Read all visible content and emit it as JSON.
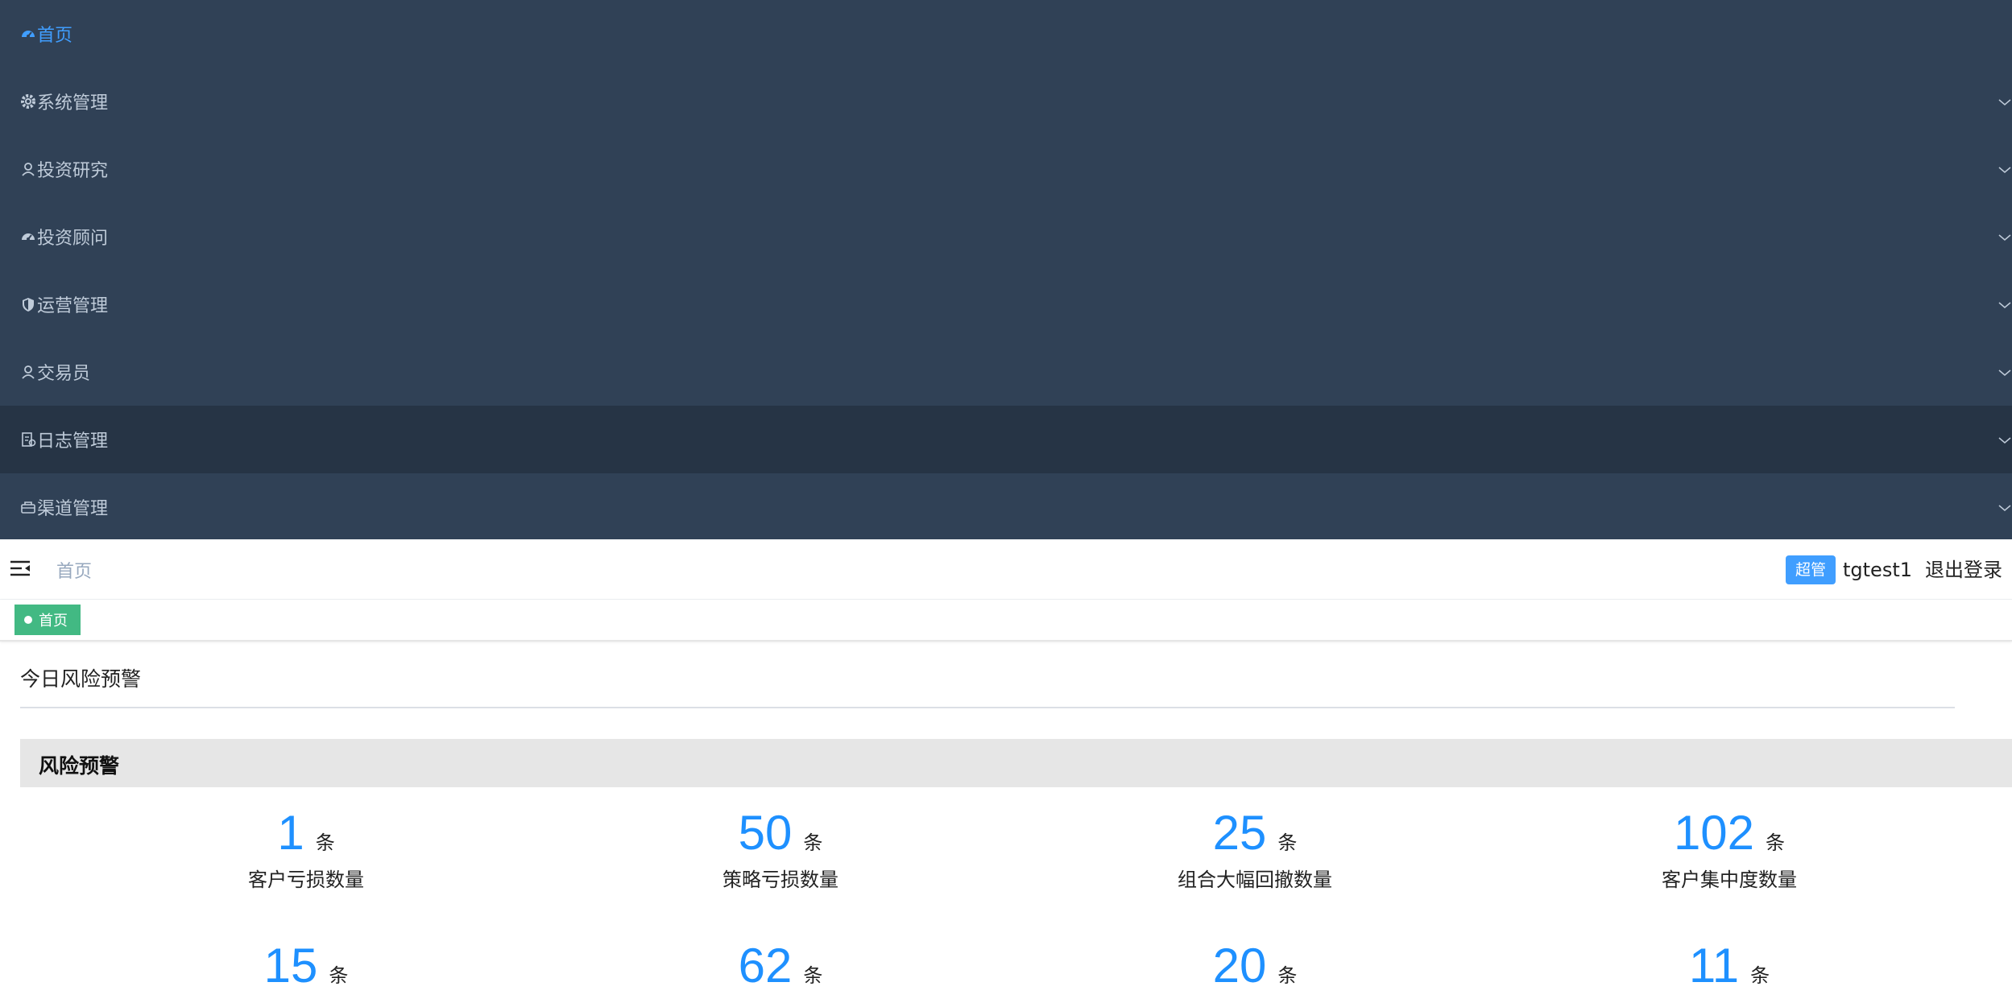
{
  "sidebar": {
    "items": [
      {
        "label": "首页",
        "icon": "dashboard-icon",
        "active": true
      },
      {
        "label": "系统管理",
        "icon": "gear-icon"
      },
      {
        "label": "投资研究",
        "icon": "user-icon"
      },
      {
        "label": "投资顾问",
        "icon": "dashboard-icon"
      },
      {
        "label": "运营管理",
        "icon": "shield-icon"
      },
      {
        "label": "交易员",
        "icon": "user-icon"
      },
      {
        "label": "日志管理",
        "icon": "log-icon"
      },
      {
        "label": "渠道管理",
        "icon": "channel-icon"
      }
    ]
  },
  "navbar": {
    "breadcrumb": "首页",
    "role_badge": "超管",
    "username": "tgtest1",
    "logout": "退出登录"
  },
  "tags": {
    "home": "首页"
  },
  "panel": {
    "title": "今日风险预警",
    "section_title": "风险预警",
    "stats": [
      {
        "value": "1",
        "unit": "条",
        "label": "客户亏损数量"
      },
      {
        "value": "50",
        "unit": "条",
        "label": "策略亏损数量"
      },
      {
        "value": "25",
        "unit": "条",
        "label": "组合大幅回撤数量"
      },
      {
        "value": "102",
        "unit": "条",
        "label": "客户集中度数量"
      },
      {
        "value": "15",
        "unit": "条"
      },
      {
        "value": "62",
        "unit": "条"
      },
      {
        "value": "20",
        "unit": "条"
      },
      {
        "value": "11",
        "unit": "条"
      }
    ]
  },
  "colors": {
    "sidebar_bg": "#304156",
    "sidebar_active_bg": "#263445",
    "sidebar_text": "#bfcbd9",
    "accent": "#409eff",
    "tag_active": "#42b983",
    "stat_number": "#1e90ff"
  }
}
